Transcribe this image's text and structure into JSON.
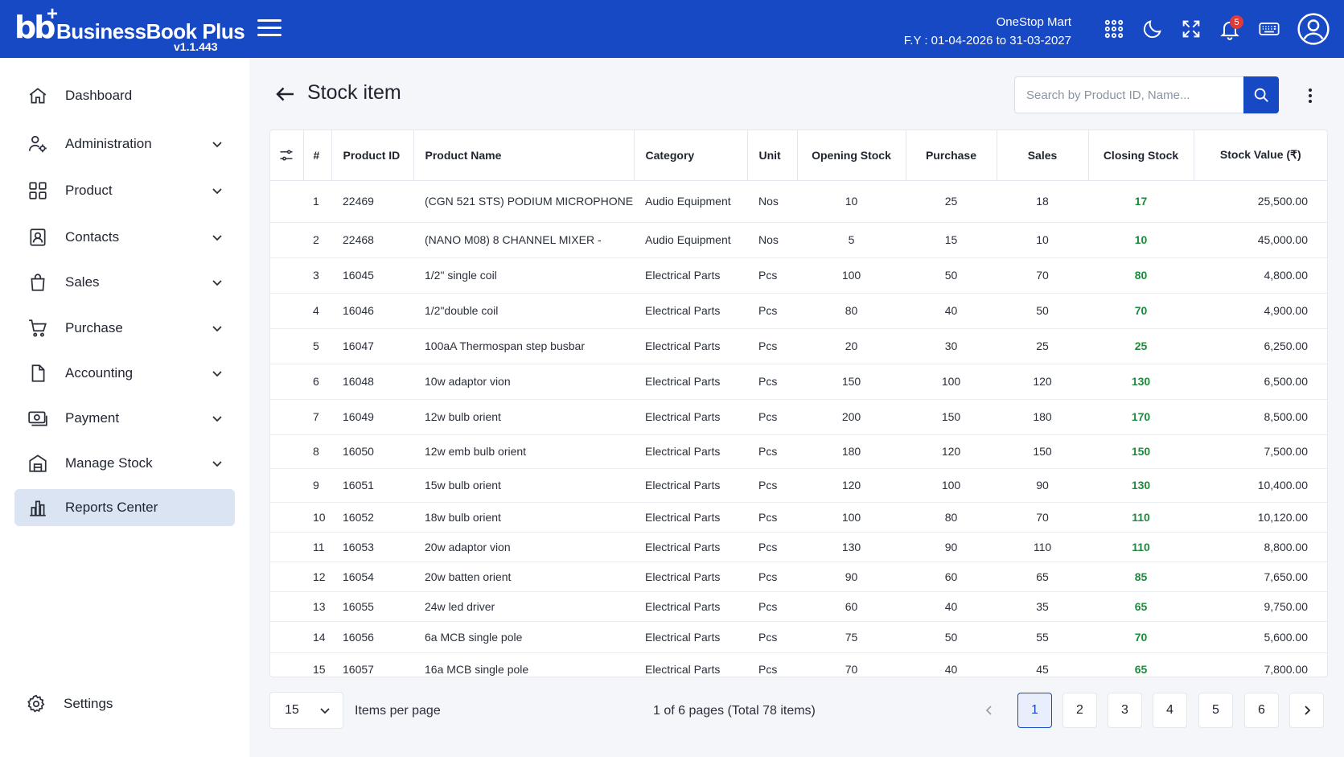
{
  "app": {
    "logo_mark": "bb",
    "logo_plus": "+",
    "name": "BusinessBook Plus",
    "version": "v1.1.443"
  },
  "header": {
    "company": "OneStop Mart",
    "fy": "F.Y : 01-04-2026 to 31-03-2027",
    "notifications": "5"
  },
  "sidebar": {
    "items": [
      {
        "label": "Dashboard",
        "icon": "home-icon"
      },
      {
        "label": "Administration",
        "icon": "users-gear-icon"
      },
      {
        "label": "Product",
        "icon": "grid-icon"
      },
      {
        "label": "Contacts",
        "icon": "contact-card-icon"
      },
      {
        "label": "Sales",
        "icon": "shopping-bag-icon"
      },
      {
        "label": "Purchase",
        "icon": "cart-icon"
      },
      {
        "label": "Accounting",
        "icon": "document-icon"
      },
      {
        "label": "Payment",
        "icon": "cash-icon"
      },
      {
        "label": "Manage Stock",
        "icon": "warehouse-icon"
      },
      {
        "label": "Reports Center",
        "icon": "bar-chart-icon"
      }
    ],
    "settings_label": "Settings"
  },
  "main": {
    "title": "Stock item",
    "search_placeholder": "Search by Product ID, Name..."
  },
  "table": {
    "columns": [
      "#",
      "Product ID",
      "Product Name",
      "Category",
      "Unit",
      "Opening Stock",
      "Purchase",
      "Sales",
      "Closing Stock",
      "Stock Value (₹)"
    ],
    "rows": [
      [
        "1",
        "22469",
        "(CGN 521 STS) PODIUM MICROPHONE",
        "Audio Equipment",
        "Nos",
        "10",
        "25",
        "18",
        "17",
        "25,500.00"
      ],
      [
        "2",
        "22468",
        "(NANO M08) 8 CHANNEL MIXER -",
        "Audio Equipment",
        "Nos",
        "5",
        "15",
        "10",
        "10",
        "45,000.00"
      ],
      [
        "3",
        "16045",
        "1/2\" single coil",
        "Electrical Parts",
        "Pcs",
        "100",
        "50",
        "70",
        "80",
        "4,800.00"
      ],
      [
        "4",
        "16046",
        "1/2\"double coil",
        "Electrical Parts",
        "Pcs",
        "80",
        "40",
        "50",
        "70",
        "4,900.00"
      ],
      [
        "5",
        "16047",
        "100aA Thermospan step busbar",
        "Electrical Parts",
        "Pcs",
        "20",
        "30",
        "25",
        "25",
        "6,250.00"
      ],
      [
        "6",
        "16048",
        "10w adaptor vion",
        "Electrical Parts",
        "Pcs",
        "150",
        "100",
        "120",
        "130",
        "6,500.00"
      ],
      [
        "7",
        "16049",
        "12w bulb orient",
        "Electrical Parts",
        "Pcs",
        "200",
        "150",
        "180",
        "170",
        "8,500.00"
      ],
      [
        "8",
        "16050",
        "12w emb bulb orient",
        "Electrical Parts",
        "Pcs",
        "180",
        "120",
        "150",
        "150",
        "7,500.00"
      ],
      [
        "9",
        "16051",
        "15w bulb orient",
        "Electrical Parts",
        "Pcs",
        "120",
        "100",
        "90",
        "130",
        "10,400.00"
      ],
      [
        "10",
        "16052",
        "18w bulb orient",
        "Electrical Parts",
        "Pcs",
        "100",
        "80",
        "70",
        "110",
        "10,120.00"
      ],
      [
        "11",
        "16053",
        "20w adaptor vion",
        "Electrical Parts",
        "Pcs",
        "130",
        "90",
        "110",
        "110",
        "8,800.00"
      ],
      [
        "12",
        "16054",
        "20w batten orient",
        "Electrical Parts",
        "Pcs",
        "90",
        "60",
        "65",
        "85",
        "7,650.00"
      ],
      [
        "13",
        "16055",
        "24w led driver",
        "Electrical Parts",
        "Pcs",
        "60",
        "40",
        "35",
        "65",
        "9,750.00"
      ],
      [
        "14",
        "16056",
        "6a MCB single pole",
        "Electrical Parts",
        "Pcs",
        "75",
        "50",
        "55",
        "70",
        "5,600.00"
      ],
      [
        "15",
        "16057",
        "16a MCB single pole",
        "Electrical Parts",
        "Pcs",
        "70",
        "40",
        "45",
        "65",
        "7,800.00"
      ]
    ]
  },
  "pagination": {
    "per_page": "15",
    "per_page_label": "Items per page",
    "info": "1 of 6 pages (Total 78 items)",
    "pages": [
      "1",
      "2",
      "3",
      "4",
      "5",
      "6"
    ],
    "active_page": "1"
  },
  "colors": {
    "brand": "#1749c4",
    "closing_stock": "#1e8a3c",
    "active_nav": "#dbe4f3",
    "badge": "#e53935"
  }
}
